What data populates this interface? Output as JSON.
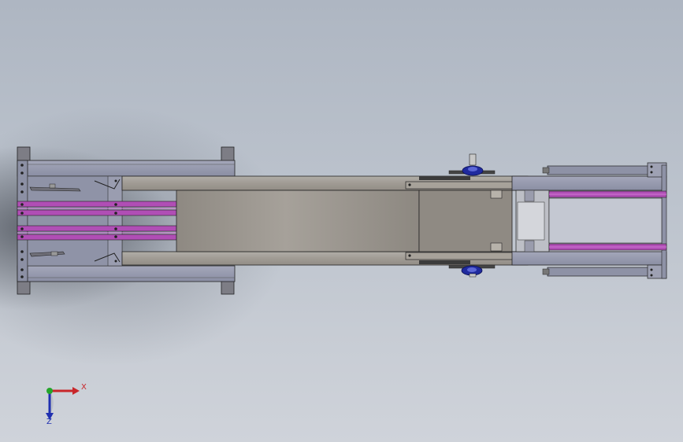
{
  "viewport": {
    "background_top": "#aeb6c2",
    "background_bottom": "#cfd3da"
  },
  "model": {
    "view": "top",
    "colors": {
      "frame_fill": "#8f93a8",
      "frame_light": "#a9acbc",
      "steel": "#a7a29a",
      "steel_dark": "#8a857e",
      "belt": "#b04eb5",
      "belt_light": "#d07ad4",
      "bearing": "#1f2a9e",
      "edge": "#1a1a1a"
    }
  },
  "triad": {
    "x_label": "X",
    "z_label": "Z",
    "x_color": "#c8262a",
    "y_color": "#25a52a",
    "z_color": "#2030b0"
  }
}
